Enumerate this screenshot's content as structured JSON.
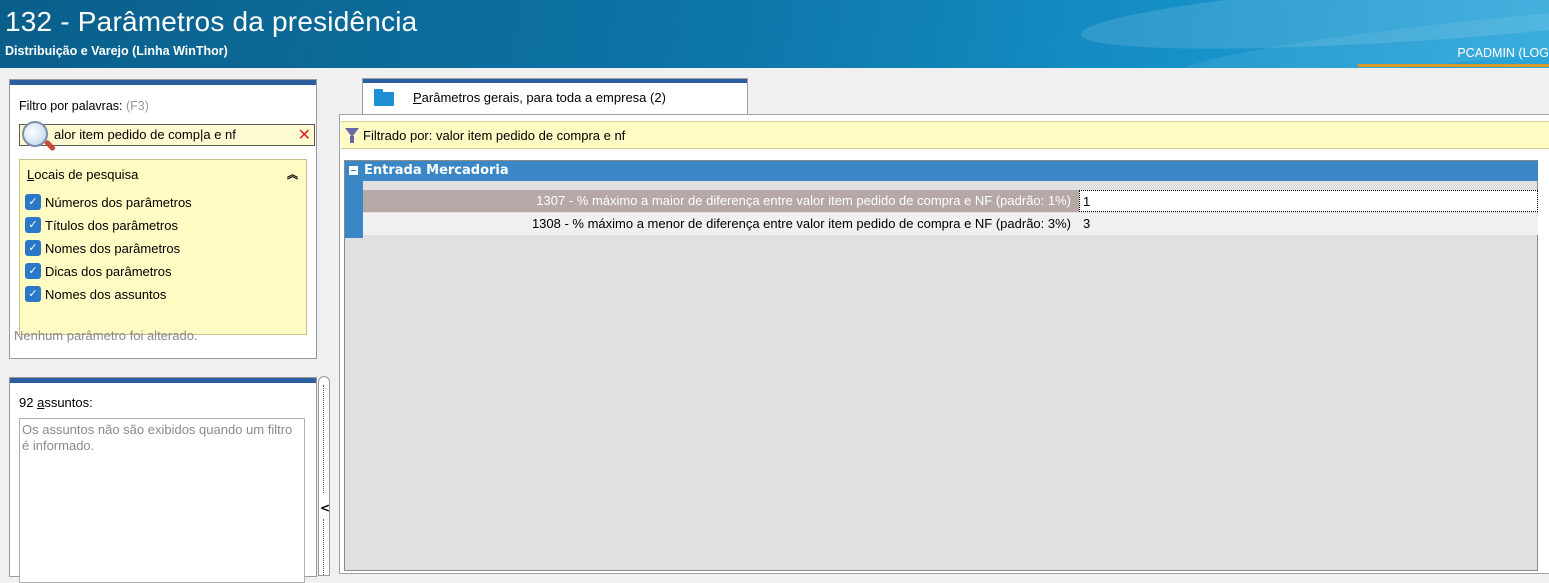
{
  "window": {
    "title": "132 - Parâmetros da presidência",
    "subtitle": "Distribuição e Varejo (Linha WinThor)",
    "user": "PCADMIN (LOG"
  },
  "filter_panel": {
    "label": "Filtro por palavras:",
    "shortcut": "(F3)",
    "search_value": "alor item pedido de comp|a e nf",
    "search_clear_icon": "close-icon",
    "locais": {
      "title_underlined": "L",
      "title_rest": "ocais de pesquisa",
      "collapse_glyph": "⌃⌃",
      "options": [
        {
          "label": "Números dos parâmetros",
          "checked": true
        },
        {
          "label": "Títulos dos parâmetros",
          "checked": true
        },
        {
          "label": "Nomes dos parâmetros",
          "checked": true
        },
        {
          "label": "Dicas dos parâmetros",
          "checked": true
        },
        {
          "label": "Nomes dos assuntos",
          "checked": true
        }
      ]
    },
    "status": "Nenhum parâmetro foi alterado."
  },
  "subjects_panel": {
    "count_prefix": "92 ",
    "count_underlined": "a",
    "count_rest": "ssuntos:",
    "note": "Os assuntos não são exibidos quando um filtro é informado."
  },
  "splitter": {
    "arrow": "<"
  },
  "tab": {
    "label_underlined": "P",
    "label_rest": "arâmetros gerais, para toda a empresa  (2)"
  },
  "filter_bar": {
    "text": "Filtrado por: valor item pedido de compra e nf"
  },
  "grid": {
    "group": "Entrada Mercadoria",
    "rows": [
      {
        "name": "1307 - % máximo a maior de diferença entre valor item pedido de compra e NF (padrão: 1%)",
        "value": "1",
        "selected": true
      },
      {
        "name": "1308 - % máximo a menor de diferença entre valor item pedido de compra e NF (padrão: 3%)",
        "value": "3",
        "selected": false
      }
    ]
  },
  "colors": {
    "header_blue": "#0d74a6",
    "accent_blue": "#2c5fa0",
    "group_blue": "#3b87c5",
    "highlight_yellow": "#fffbc2",
    "selected_row": "#b5a8a6",
    "user_underline": "#d99a2b"
  }
}
